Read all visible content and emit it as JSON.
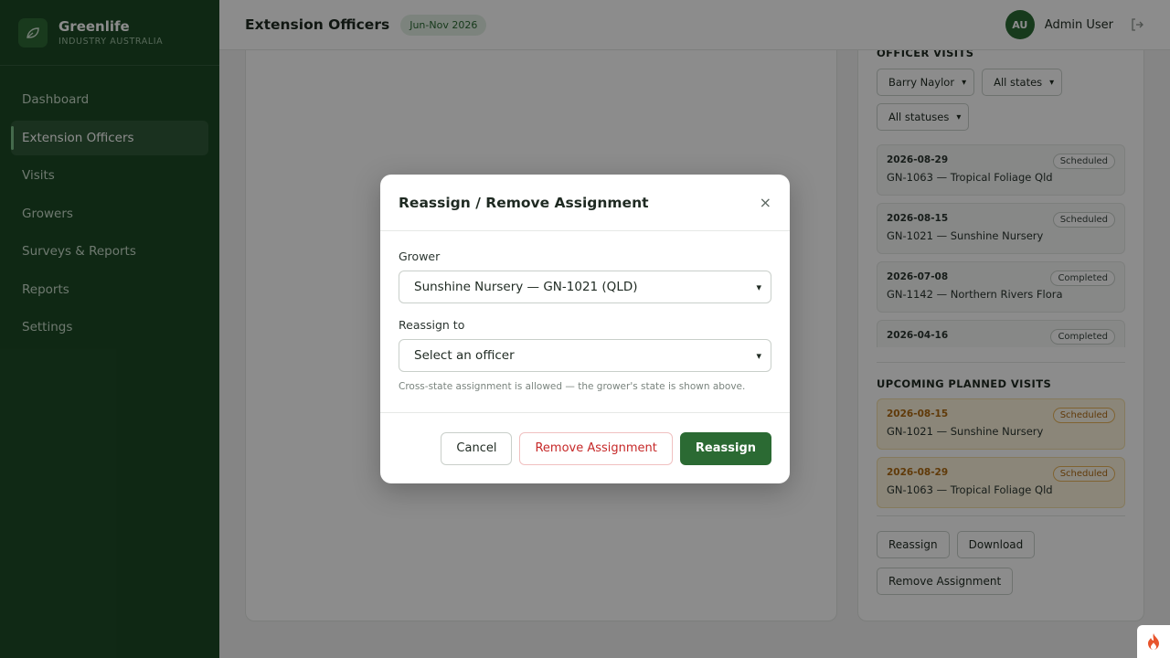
{
  "brand": {
    "name": "Greenlife",
    "subtitle": "INDUSTRY AUSTRALIA"
  },
  "sidebar": {
    "items": [
      {
        "label": "Dashboard"
      },
      {
        "label": "Extension Officers",
        "active": true
      },
      {
        "label": "Visits"
      },
      {
        "label": "Growers"
      },
      {
        "label": "Surveys & Reports"
      },
      {
        "label": "Reports"
      },
      {
        "label": "Settings"
      }
    ]
  },
  "header": {
    "title": "Extension Officers",
    "period": "Jun-Nov 2026",
    "user_initials": "AU",
    "user_name": "Admin User"
  },
  "side_panel": {
    "visits_heading": "OFFICER VISITS",
    "filters": {
      "officer": "Barry Naylor",
      "state": "All states",
      "status": "All statuses"
    },
    "visits": [
      {
        "date": "2026-08-29",
        "title": "GN-1063 — Tropical Foliage Qld",
        "status": "Scheduled"
      },
      {
        "date": "2026-08-15",
        "title": "GN-1021 — Sunshine Nursery",
        "status": "Scheduled"
      },
      {
        "date": "2026-07-08",
        "title": "GN-1142 — Northern Rivers Flora",
        "status": "Completed"
      },
      {
        "date": "2026-04-16",
        "title": "",
        "status": "Completed"
      }
    ],
    "planned_heading": "UPCOMING PLANNED VISITS",
    "planned": [
      {
        "date": "2026-08-15",
        "title": "GN-1021 — Sunshine Nursery",
        "status": "Scheduled"
      },
      {
        "date": "2026-08-29",
        "title": "GN-1063 — Tropical Foliage Qld",
        "status": "Scheduled"
      }
    ],
    "actions": {
      "reassign": "Reassign",
      "download": "Download",
      "remove": "Remove Assignment"
    }
  },
  "modal": {
    "title": "Reassign / Remove Assignment",
    "close": "×",
    "grower_label": "Grower",
    "grower_value": "Sunshine Nursery — GN-1021 (QLD)",
    "reassign_label": "Reassign to",
    "reassign_value": "Select an officer",
    "hint": "Cross-state assignment is allowed — the grower's state is shown above.",
    "cancel": "Cancel",
    "remove": "Remove Assignment",
    "submit": "Reassign"
  },
  "icons": {
    "logo": "leaf-icon",
    "logout": "logout-icon",
    "corner": "flame-icon",
    "chevron": "chevron-down-icon"
  },
  "colors": {
    "sidebar": "#1d4a26",
    "primary": "#2b6a33",
    "danger": "#c62828",
    "planned": "#b06a12"
  }
}
